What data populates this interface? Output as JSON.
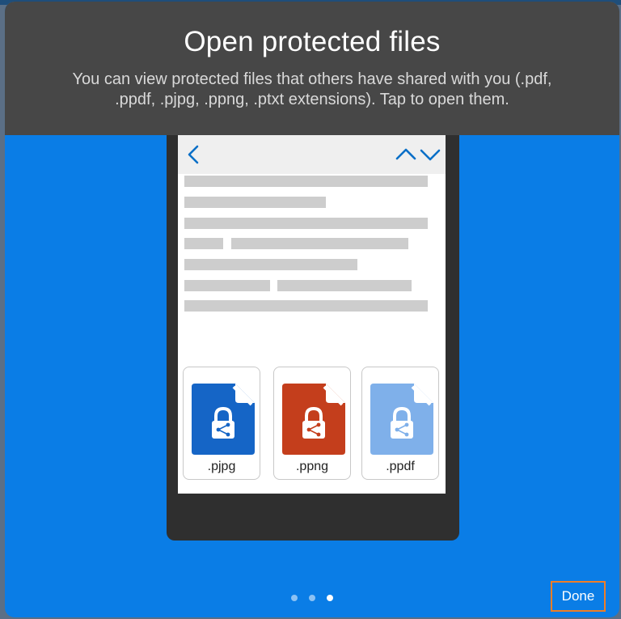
{
  "dialog": {
    "title": "Open protected files",
    "subtitle": "You can view protected files that others have shared with you (.pdf, .ppdf, .pjpg, .ppng, .ptxt extensions). Tap to open them."
  },
  "viewer": {
    "icons": {
      "back": "chevron-left-icon",
      "previous": "chevron-up-icon",
      "next": "chevron-down-icon"
    }
  },
  "files": [
    {
      "label": ".pjpg",
      "color": "#1565c6",
      "icon": "locked-file-icon"
    },
    {
      "label": ".ppng",
      "color": "#c43e1c",
      "icon": "locked-file-icon"
    },
    {
      "label": ".ppdf",
      "color": "#7fb0ea",
      "icon": "locked-file-icon"
    }
  ],
  "pagination": {
    "count": 3,
    "active_index": 2
  },
  "footer": {
    "done_label": "Done"
  },
  "colors": {
    "sheet_background": "#0a7de6",
    "header_background": "#474747",
    "accent": "#0a6fc7",
    "focus_outline": "#f07e26"
  }
}
